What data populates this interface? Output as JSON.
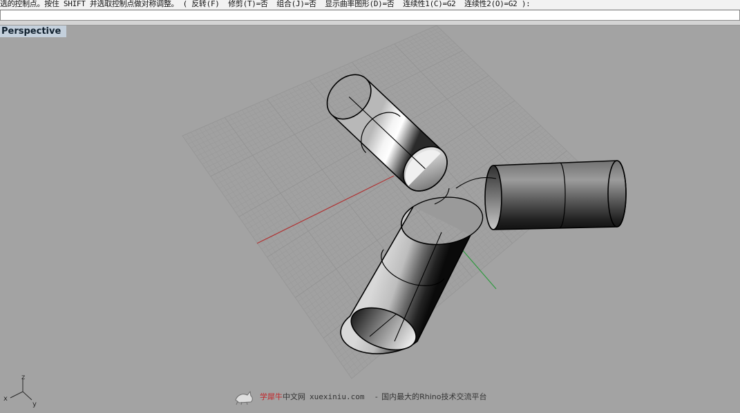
{
  "command_line": {
    "prompt": "选的控制点。按住 SHIFT 并选取控制点做对称调整。 ( 反转(F)  修剪(T)=否  组合(J)=否  显示曲率图形(D)=否  连续性1(C)=G2  连续性2(O)=G2 ):",
    "input_value": ""
  },
  "viewport": {
    "title": "Perspective",
    "background": "#a3a3a3",
    "grid_color": "#9a9a9a",
    "x_axis_color": "#b03434",
    "y_axis_color": "#2f9a3f"
  },
  "axis_gizmo": {
    "x": "x",
    "y": "y",
    "z": "z"
  },
  "watermark": {
    "brand": "学犀牛",
    "brand_suffix": "中文网",
    "url": "xuexiniu.com",
    "dash": "-",
    "slogan": "国内最大的Rhino技术交流平台"
  }
}
